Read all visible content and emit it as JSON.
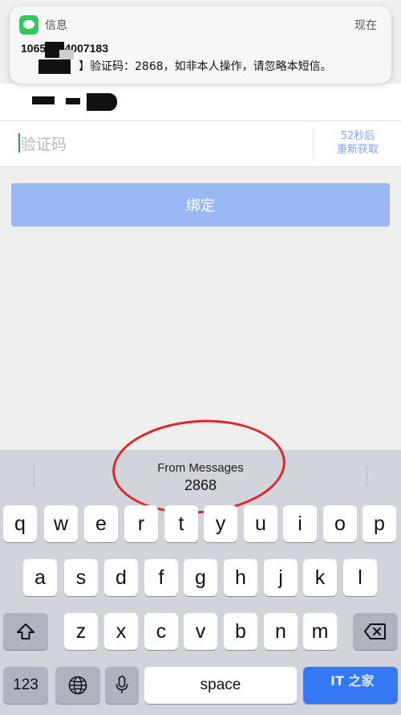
{
  "notification": {
    "app": "信息",
    "time": "现在",
    "sender": "10655024007183",
    "body": "】验证码：2868，如非本人操作，请忽略本短信。"
  },
  "form": {
    "code_placeholder": "验证码",
    "resend_line1": "52秒后",
    "resend_line2": "重新获取",
    "bind_label": "绑定"
  },
  "keyboard": {
    "quicktype_title": "From Messages",
    "quicktype_code": "2868",
    "row1": [
      "q",
      "w",
      "e",
      "r",
      "t",
      "y",
      "u",
      "i",
      "o",
      "p"
    ],
    "row2": [
      "a",
      "s",
      "d",
      "f",
      "g",
      "h",
      "j",
      "k",
      "l"
    ],
    "row3": [
      "z",
      "x",
      "c",
      "v",
      "b",
      "n",
      "m"
    ],
    "numbers_label": "123",
    "space_label": "space",
    "shift_icon": "shift-icon",
    "delete_icon": "delete-icon",
    "globe_icon": "globe-icon",
    "mic_icon": "mic-icon"
  },
  "watermark": "IT之家",
  "colors": {
    "accent": "#3478f6",
    "button": "#9ab8f3",
    "messages_green": "#34c759",
    "annotation_red": "#e0262a"
  }
}
